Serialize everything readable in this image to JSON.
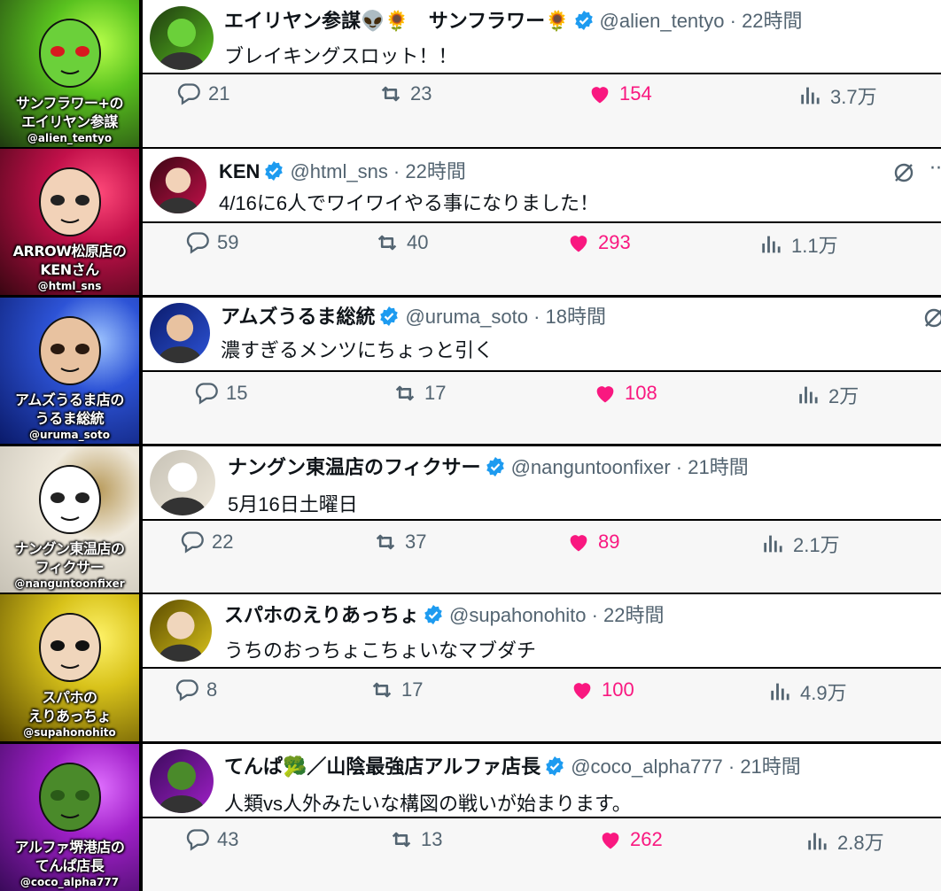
{
  "colors": {
    "like": "#f91880",
    "muted": "#536471",
    "verified": "#1d9bf0",
    "text": "#0f1419"
  },
  "posts": [
    {
      "card": {
        "line1": "サンフラワー+の",
        "line2": "エイリヤン参謀",
        "handle": "@alien_tentyo",
        "bg": "lightning-green"
      },
      "name": "エイリヤン参謀👽🌻　サンフラワー🌻",
      "handle": "@alien_tentyo · 22時間",
      "text": "ブレイキングスロット！！",
      "stats": {
        "replies": "21",
        "reposts": "23",
        "likes": "154",
        "views": "3.7万"
      }
    },
    {
      "card": {
        "line1": "ARROW松原店の",
        "line2": "KENさん",
        "handle": "@html_sns",
        "bg": "lightning-red"
      },
      "name": "KEN",
      "handle": "@html_sns · 22時間",
      "text": "4/16に6人でワイワイやる事になりました！",
      "stats": {
        "replies": "59",
        "reposts": "40",
        "likes": "293",
        "views": "1.1万"
      }
    },
    {
      "card": {
        "line1": "アムズうるま店の",
        "line2": "うるま総統",
        "handle": "@uruma_soto",
        "bg": "lightning-blue"
      },
      "name": "アムズうるま総統",
      "handle": "@uruma_soto · 18時間",
      "text": "濃すぎるメンツにちょっと引く",
      "stats": {
        "replies": "15",
        "reposts": "17",
        "likes": "108",
        "views": "2万"
      }
    },
    {
      "card": {
        "line1": "ナングン東温店の",
        "line2": "フィクサー",
        "handle": "@nanguntoonfixer",
        "bg": "light"
      },
      "name": "ナングン東温店のフィクサー",
      "handle": "@nanguntoonfixer · 21時間",
      "text": "5月16日土曜日",
      "stats": {
        "replies": "22",
        "reposts": "37",
        "likes": "89",
        "views": "2.1万"
      }
    },
    {
      "card": {
        "line1": "スパホの",
        "line2": "えりあっちょ",
        "handle": "@supahonohito",
        "bg": "lightning-yellow"
      },
      "name": "スパホのえりあっちょ",
      "handle": "@supahonohito · 22時間",
      "text": "うちのおっちょこちょいなマブダチ",
      "stats": {
        "replies": "8",
        "reposts": "17",
        "likes": "100",
        "views": "4.9万"
      }
    },
    {
      "card": {
        "line1": "アルファ堺港店の",
        "line2": "てんぱ店長",
        "handle": "@coco_alpha777",
        "bg": "lightning-purple"
      },
      "name": "てんぱ🥦／山陰最強店アルファ店長",
      "handle": "@coco_alpha777 · 21時間",
      "text": "人類vs人外みたいな構図の戦いが始まります。",
      "stats": {
        "replies": "43",
        "reposts": "13",
        "likes": "262",
        "views": "2.8万"
      }
    }
  ]
}
